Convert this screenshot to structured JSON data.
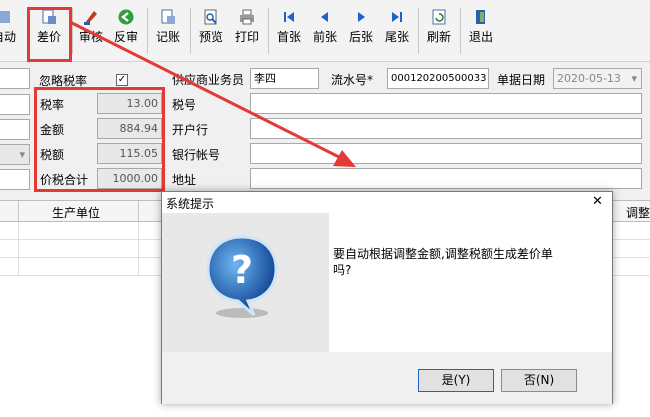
{
  "toolbar": {
    "items": [
      {
        "label": "自动",
        "icon": "auto-icon"
      },
      {
        "label": "差价",
        "icon": "price-diff-icon"
      },
      {
        "label": "审核",
        "icon": "audit-icon"
      },
      {
        "label": "反审",
        "icon": "unaudit-icon"
      },
      {
        "label": "记账",
        "icon": "bookkeep-icon"
      },
      {
        "label": "预览",
        "icon": "preview-icon"
      },
      {
        "label": "打印",
        "icon": "print-icon"
      },
      {
        "label": "首张",
        "icon": "first-icon"
      },
      {
        "label": "前张",
        "icon": "prev-icon"
      },
      {
        "label": "后张",
        "icon": "next-icon"
      },
      {
        "label": "尾张",
        "icon": "last-icon"
      },
      {
        "label": "刷新",
        "icon": "refresh-icon"
      },
      {
        "label": "退出",
        "icon": "exit-icon"
      }
    ]
  },
  "form": {
    "ignore_tax_label": "忽略税率",
    "tax_rate_label": "税率",
    "tax_rate_value": "13.00",
    "amount_label": "金额",
    "amount_value": "884.94",
    "tax_amount_label": "税额",
    "tax_amount_value": "115.05",
    "total_label": "价税合计",
    "total_value": "1000.00",
    "salesman_label": "供应商业务员",
    "salesman_value": "李四",
    "serial_label": "流水号*",
    "serial_value": "000120200500033",
    "date_label": "单据日期",
    "date_value": "2020-05-13",
    "taxno_label": "税号",
    "bank_label": "开户行",
    "account_label": "银行帐号",
    "address_label": "地址"
  },
  "grid": {
    "col_producer": "生产单位",
    "col_adjust": "调整"
  },
  "dialog": {
    "title": "系统提示",
    "close": "✕",
    "message_line1": "要自动根据调整金额,调整税额生成差价单",
    "message_line2": "吗?",
    "yes_label": "是(Y)",
    "no_label": "否(N)"
  },
  "colors": {
    "highlight": "#e53935",
    "accent": "#1e63c8"
  }
}
